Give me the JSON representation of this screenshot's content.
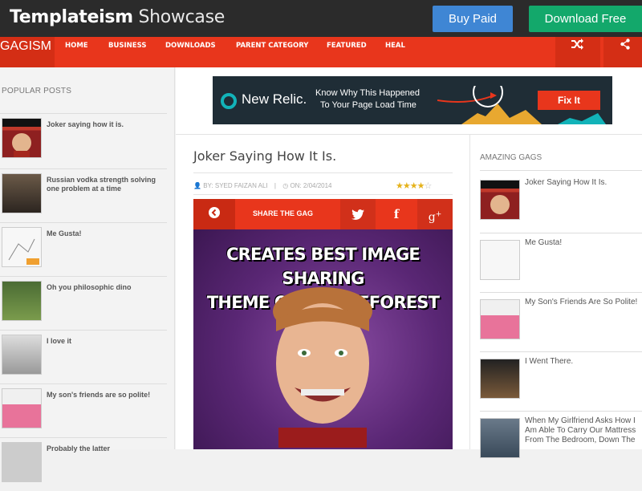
{
  "topbar": {
    "brand_bold": "Templateism",
    "brand_light": "Showcase",
    "buy_label": "Buy Paid",
    "download_label": "Download Free"
  },
  "nav": {
    "logo": "GAGISM",
    "items": [
      "HOME",
      "BUSINESS",
      "DOWNLOADS",
      "PARENT CATEGORY",
      "FEATURED",
      "HEAL"
    ],
    "shuffle_icon": "shuffle-icon",
    "share_icon": "share-icon"
  },
  "sidebar": {
    "title": "POPULAR POSTS",
    "items": [
      {
        "label": "Joker saying how it is.",
        "thumb": "meme-thumb-red"
      },
      {
        "label": "Russian vodka strength solving one problem at a time",
        "thumb": "meme-thumb-dark"
      },
      {
        "label": "Me Gusta!",
        "thumb": "meme-thumb-light"
      },
      {
        "label": "Oh you philosophic dino",
        "thumb": "meme-thumb-green"
      },
      {
        "label": "I love it",
        "thumb": "meme-thumb-gray"
      },
      {
        "label": "My son's friends are so polite!",
        "thumb": "meme-thumb-pink"
      },
      {
        "label": "Probably the latter",
        "thumb": "meme-thumb-dark"
      }
    ]
  },
  "ad": {
    "brand": "New Relic.",
    "line1": "Know Why This Happened",
    "line2": "To Your Page Load Time",
    "button": "Fix It"
  },
  "post": {
    "title": "Joker Saying How It Is.",
    "author": "BY: SYED FAIZAN ALI",
    "date": "ON: 2/04/2014",
    "rating": 4,
    "share_label": "SHARE THE GAG",
    "meme_line1": "CREATES BEST IMAGE SHARING",
    "meme_line2": "THEME ON THEMEFOREST"
  },
  "right": {
    "title": "AMAZING GAGS",
    "items": [
      {
        "label": "Joker Saying How It Is."
      },
      {
        "label": "Me Gusta!"
      },
      {
        "label": "My Son's Friends Are So Polite!"
      },
      {
        "label": "I Went There."
      },
      {
        "label": "When My Girlfriend Asks How I Am Able To Carry Our Mattress From The Bedroom, Down The"
      }
    ]
  },
  "colors": {
    "navbar": "#e8361c",
    "topbar": "#2b2b2b",
    "buy": "#3f86d4",
    "download": "#13a86b"
  }
}
